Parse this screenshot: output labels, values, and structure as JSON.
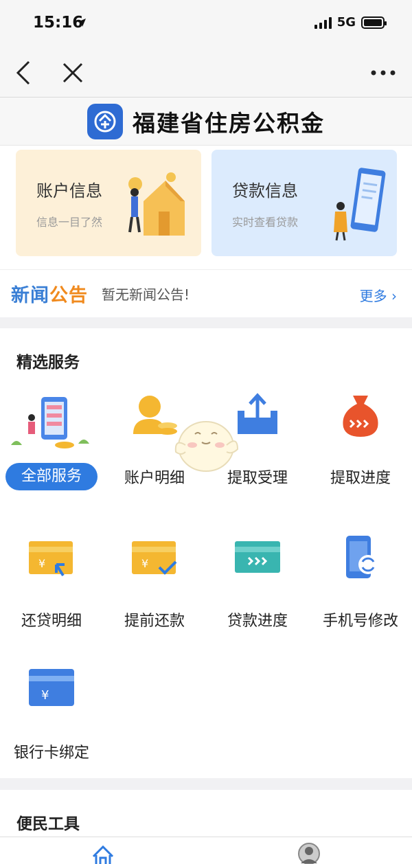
{
  "status_bar": {
    "time": "15:16",
    "network": "5G"
  },
  "header": {
    "title": "福建省住房公积金"
  },
  "cards": [
    {
      "title": "账户信息",
      "subtitle": "信息一目了然"
    },
    {
      "title": "贷款信息",
      "subtitle": "实时查看贷款"
    }
  ],
  "news": {
    "badge_part1": "新闻",
    "badge_part2": "公告",
    "text": "暂无新闻公告!",
    "more": "更多"
  },
  "services": {
    "title": "精选服务",
    "items": [
      {
        "label": "全部服务",
        "icon": "all-services-icon"
      },
      {
        "label": "账户明细",
        "icon": "account-detail-icon"
      },
      {
        "label": "提取受理",
        "icon": "withdraw-accept-icon"
      },
      {
        "label": "提取进度",
        "icon": "withdraw-progress-icon"
      },
      {
        "label": "还贷明细",
        "icon": "repayment-detail-icon"
      },
      {
        "label": "提前还款",
        "icon": "prepayment-icon"
      },
      {
        "label": "贷款进度",
        "icon": "loan-progress-icon"
      },
      {
        "label": "手机号修改",
        "icon": "phone-change-icon"
      },
      {
        "label": "银行卡绑定",
        "icon": "bank-card-icon"
      }
    ]
  },
  "tools": {
    "title": "便民工具"
  },
  "colors": {
    "primary": "#2f7be0",
    "orange": "#f08a1e",
    "gold": "#f4b731",
    "teal": "#39b5b0"
  }
}
